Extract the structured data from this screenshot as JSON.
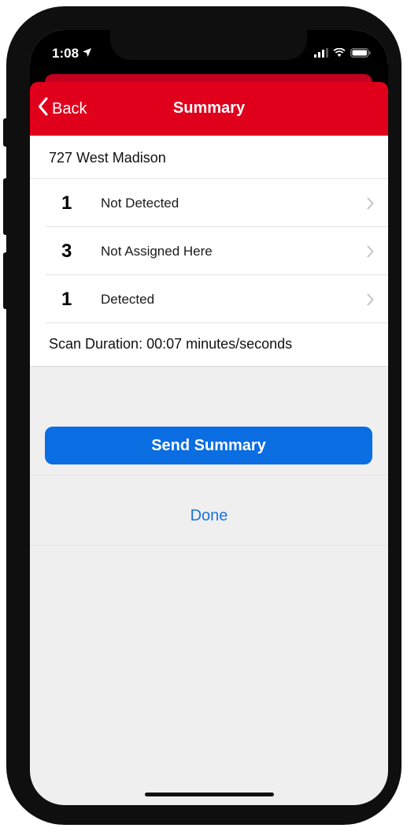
{
  "status_bar": {
    "time": "1:08",
    "icons": [
      "location-arrow-icon",
      "signal-icon",
      "wifi-icon",
      "battery-icon"
    ]
  },
  "nav": {
    "back_label": "Back",
    "title": "Summary"
  },
  "address": "727 West Madison",
  "rows": [
    {
      "count": "1",
      "label": "Not Detected"
    },
    {
      "count": "3",
      "label": "Not Assigned Here"
    },
    {
      "count": "1",
      "label": "Detected"
    }
  ],
  "scan_duration": "Scan Duration: 00:07 minutes/seconds",
  "actions": {
    "send_label": "Send Summary",
    "done_label": "Done"
  },
  "colors": {
    "nav_red": "#e0001c",
    "primary_blue": "#0a6de2",
    "link_blue": "#1a73e0"
  }
}
